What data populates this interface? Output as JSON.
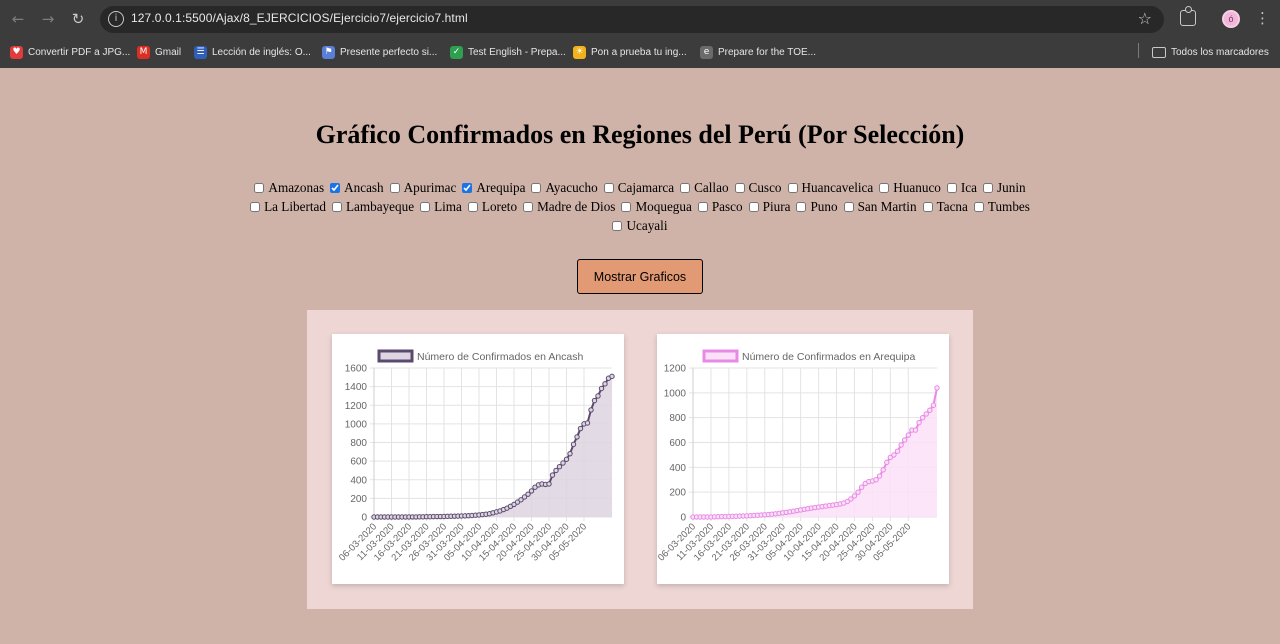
{
  "browser": {
    "url": "127.0.0.1:5500/Ajax/8_EJERCICIOS/Ejercicio7/ejercicio7.html",
    "profile_initial": "ó",
    "bookmarks": [
      {
        "label": "Convertir PDF a JPG...",
        "icon": "heart-icon",
        "color": "#e23b3b"
      },
      {
        "label": "Gmail",
        "icon": "gmail-icon",
        "color": "#d93025"
      },
      {
        "label": "Lección de inglés: O...",
        "icon": "lesson-icon",
        "color": "#2f5fb8"
      },
      {
        "label": "Presente perfecto si...",
        "icon": "doc-icon",
        "color": "#5a7fd6"
      },
      {
        "label": "Test English - Prepa...",
        "icon": "check-icon",
        "color": "#2e9e4f"
      },
      {
        "label": "Pon a prueba tu ing...",
        "icon": "sun-icon",
        "color": "#f2b21b"
      },
      {
        "label": "Prepare for the TOE...",
        "icon": "ets-icon",
        "color": "#6b6b6b"
      }
    ],
    "all_bookmarks_label": "Todos los marcadores"
  },
  "page": {
    "title": "Gráfico Confirmados en Regiones del Perú (Por Selección)",
    "regions": [
      {
        "name": "Amazonas",
        "checked": false
      },
      {
        "name": "Ancash",
        "checked": true
      },
      {
        "name": "Apurimac",
        "checked": false
      },
      {
        "name": "Arequipa",
        "checked": true
      },
      {
        "name": "Ayacucho",
        "checked": false
      },
      {
        "name": "Cajamarca",
        "checked": false
      },
      {
        "name": "Callao",
        "checked": false
      },
      {
        "name": "Cusco",
        "checked": false
      },
      {
        "name": "Huancavelica",
        "checked": false
      },
      {
        "name": "Huanuco",
        "checked": false
      },
      {
        "name": "Ica",
        "checked": false
      },
      {
        "name": "Junin",
        "checked": false
      },
      {
        "name": "La Libertad",
        "checked": false
      },
      {
        "name": "Lambayeque",
        "checked": false
      },
      {
        "name": "Lima",
        "checked": false
      },
      {
        "name": "Loreto",
        "checked": false
      },
      {
        "name": "Madre de Dios",
        "checked": false
      },
      {
        "name": "Moquegua",
        "checked": false
      },
      {
        "name": "Pasco",
        "checked": false
      },
      {
        "name": "Piura",
        "checked": false
      },
      {
        "name": "Puno",
        "checked": false
      },
      {
        "name": "San Martin",
        "checked": false
      },
      {
        "name": "Tacna",
        "checked": false
      },
      {
        "name": "Tumbes",
        "checked": false
      },
      {
        "name": "Ucayali",
        "checked": false
      }
    ],
    "button_label": "Mostrar Graficos"
  },
  "chart_data": [
    {
      "type": "line",
      "legend": "Número de Confirmados en Ancash",
      "color": "#5a4a6e",
      "fill": "#ddd5e1",
      "ylim": [
        0,
        1600
      ],
      "yticks": [
        0,
        200,
        400,
        600,
        800,
        1000,
        1200,
        1400,
        1600
      ],
      "x_tick_labels": [
        "06-03-2020",
        "11-03-2020",
        "16-03-2020",
        "21-03-2020",
        "26-03-2020",
        "31-03-2020",
        "05-04-2020",
        "10-04-2020",
        "15-04-2020",
        "20-04-2020",
        "25-04-2020",
        "30-04-2020",
        "05-05-2020"
      ],
      "start_date": "06-03-2020",
      "values": [
        0,
        0,
        0,
        0,
        0,
        0,
        0,
        0,
        0,
        0,
        1,
        1,
        1,
        2,
        2,
        3,
        3,
        4,
        5,
        5,
        6,
        7,
        8,
        9,
        10,
        11,
        12,
        14,
        16,
        19,
        22,
        26,
        30,
        35,
        45,
        55,
        65,
        80,
        95,
        115,
        135,
        160,
        185,
        215,
        245,
        280,
        320,
        345,
        355,
        350,
        355,
        450,
        500,
        540,
        580,
        620,
        680,
        780,
        860,
        950,
        1000,
        1010,
        1150,
        1250,
        1300,
        1380,
        1430,
        1490,
        1510
      ]
    },
    {
      "type": "line",
      "legend": "Número de Confirmados en Arequipa",
      "color": "#e889e6",
      "fill": "#fbe1f7",
      "ylim": [
        0,
        1200
      ],
      "yticks": [
        0,
        200,
        400,
        600,
        800,
        1000,
        1200
      ],
      "x_tick_labels": [
        "06-03-2020",
        "11-03-2020",
        "16-03-2020",
        "21-03-2020",
        "26-03-2020",
        "31-03-2020",
        "05-04-2020",
        "10-04-2020",
        "15-04-2020",
        "20-04-2020",
        "25-04-2020",
        "30-04-2020",
        "05-05-2020"
      ],
      "start_date": "06-03-2020",
      "values": [
        0,
        0,
        0,
        0,
        0,
        0,
        1,
        2,
        3,
        3,
        4,
        5,
        6,
        7,
        8,
        9,
        10,
        12,
        14,
        16,
        18,
        20,
        23,
        26,
        30,
        34,
        38,
        42,
        47,
        52,
        57,
        62,
        67,
        72,
        76,
        80,
        84,
        88,
        92,
        96,
        100,
        105,
        112,
        125,
        145,
        170,
        200,
        240,
        270,
        285,
        290,
        300,
        330,
        380,
        440,
        480,
        500,
        530,
        580,
        620,
        660,
        700,
        700,
        760,
        800,
        830,
        860,
        900,
        1040
      ]
    }
  ]
}
